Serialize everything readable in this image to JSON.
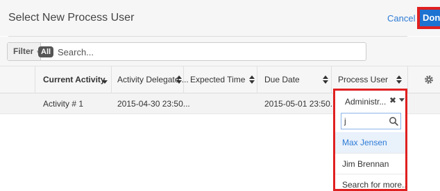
{
  "dialog": {
    "title": "Select New Process User",
    "cancel_label": "Cancel",
    "done_label": "Done"
  },
  "filter": {
    "button_label": "Filter",
    "all_pill": "All",
    "search_placeholder": "Search..."
  },
  "table": {
    "columns": [
      {
        "label": "Current Activity"
      },
      {
        "label": "Activity Delegate ..."
      },
      {
        "label": "Expected Time"
      },
      {
        "label": "Due Date"
      },
      {
        "label": "Process User"
      }
    ],
    "rows": [
      {
        "current_activity": "Activity # 1",
        "activity_delegate": "2015-04-30 23:50...",
        "expected_time": "",
        "due_date": "2015-05-01 23:50..."
      }
    ]
  },
  "process_user": {
    "selected": "Administr...",
    "search_value": "j",
    "options": [
      {
        "label": "Max Jensen"
      },
      {
        "label": "Jim Brennan"
      },
      {
        "label": "Search for more..."
      }
    ]
  },
  "colors": {
    "accent": "#2d7bd6",
    "highlight_border": "#e02020",
    "done_background": "#1d73d1"
  }
}
